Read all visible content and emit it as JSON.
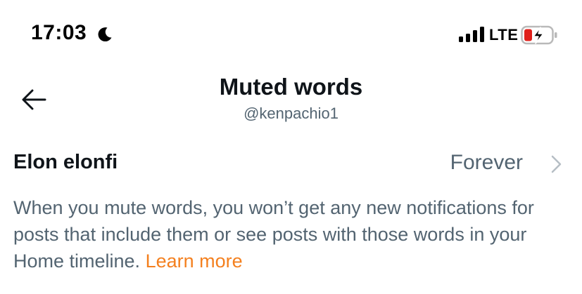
{
  "status_bar": {
    "time": "17:03",
    "network": "LTE",
    "icons": [
      "moon-icon",
      "signal-icon",
      "battery-charging-icon"
    ],
    "battery_color": "#e0201b"
  },
  "header": {
    "title": "Muted words",
    "subtitle": "@kenpachio1",
    "back_icon": "arrow-left-icon"
  },
  "muted_words": [
    {
      "word": "Elon elonfi",
      "duration": "Forever"
    }
  ],
  "description": {
    "text": "When you mute words, you won’t get any new notifications for posts that include them or see posts with those words in your Home timeline.",
    "link_label": "Learn more",
    "link_color": "#f4801f"
  }
}
